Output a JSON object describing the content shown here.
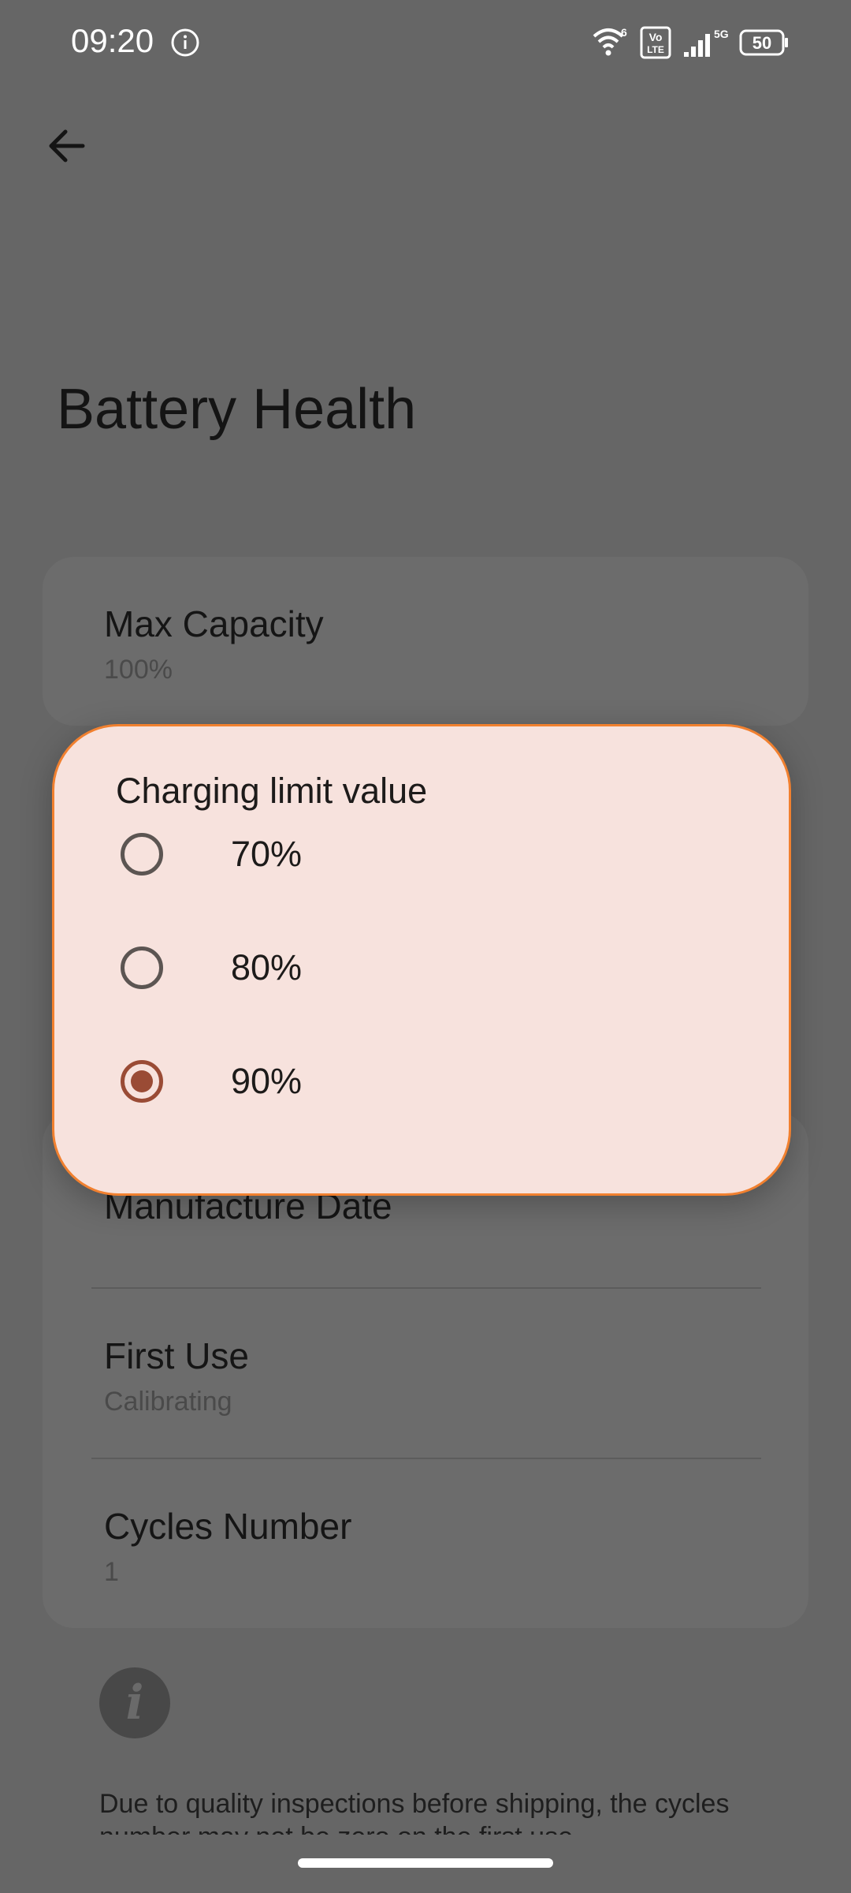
{
  "status_bar": {
    "time": "09:20",
    "wifi_badge": "6",
    "volte_top": "Vo",
    "volte_bottom": "LTE",
    "network": "5G",
    "battery_level": "50"
  },
  "header": {
    "title": "Battery Health"
  },
  "capacity_card": {
    "title": "Max Capacity",
    "value": "100%"
  },
  "details": {
    "manufacture_date": {
      "title": "Manufacture Date"
    },
    "first_use": {
      "title": "First Use",
      "value": "Calibrating"
    },
    "cycles_number": {
      "title": "Cycles Number",
      "value": "1"
    }
  },
  "footer": {
    "info_glyph": "i",
    "note": "Due to quality inspections before shipping, the cycles number may not be zero on the first use."
  },
  "dialog": {
    "title": "Charging limit value",
    "options": [
      {
        "label": "70%",
        "selected": false
      },
      {
        "label": "80%",
        "selected": false
      },
      {
        "label": "90%",
        "selected": true
      }
    ]
  },
  "colors": {
    "scrim": "#666666",
    "dialog_background": "#f7e2dd",
    "dialog_outline": "#f1802f",
    "radio_selected": "#9a4b35",
    "radio_unselected": "#5c5552"
  }
}
